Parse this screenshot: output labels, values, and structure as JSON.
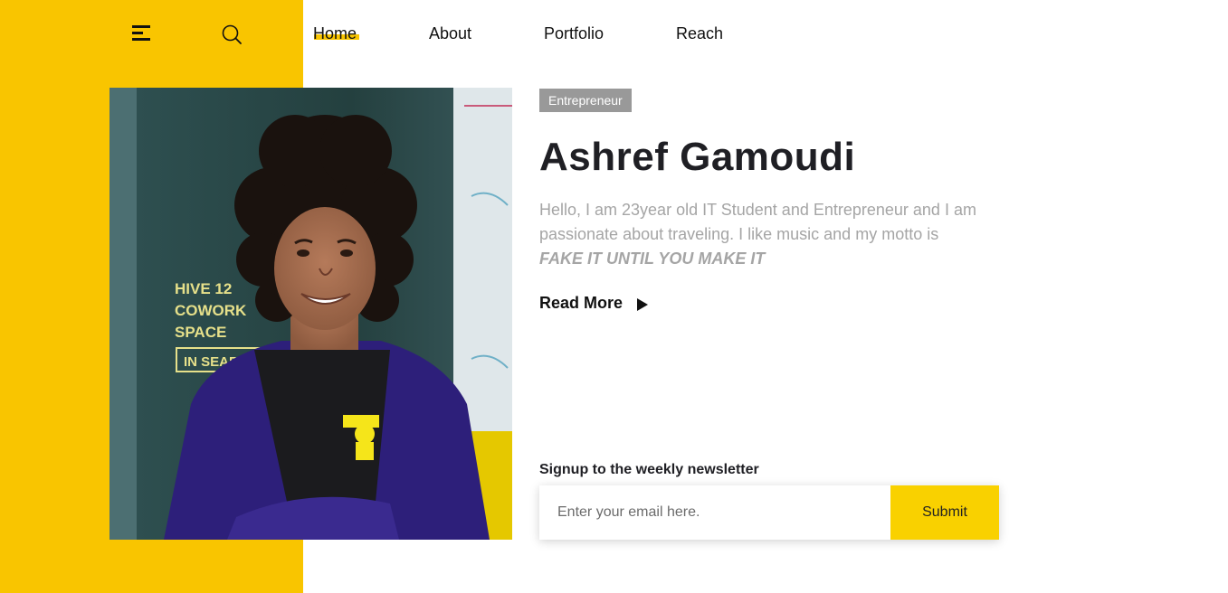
{
  "nav": {
    "items": [
      {
        "label": "Home",
        "active": true
      },
      {
        "label": "About"
      },
      {
        "label": "Portfolio"
      },
      {
        "label": "Reach"
      }
    ]
  },
  "icons": {
    "menu": "hamburger-menu-icon",
    "search": "search-icon",
    "read_more": "play-arrow-icon"
  },
  "hero": {
    "badge": "Entrepreneur",
    "name": "Ashref Gamoudi",
    "bio": "Hello, I am 23year old IT Student and Entrepreneur and I am passionate about traveling. I like music and my motto is",
    "motto": "FAKE IT UNTIL YOU MAKE IT",
    "read_more": "Read More",
    "photo_sign": {
      "line1": "HIVE 12",
      "line2": "COWORK",
      "line3": "SPACE",
      "line4": "IN SEAR"
    }
  },
  "newsletter": {
    "label": "Signup to the weekly newsletter",
    "email_placeholder": "Enter your email here.",
    "email_value": "",
    "submit_label": "Submit"
  },
  "colors": {
    "accent": "#f9c500",
    "submit_bg": "#f9d100",
    "badge_bg": "#999999",
    "text_dark": "#1f1f24",
    "text_muted": "#a5a5a5"
  }
}
